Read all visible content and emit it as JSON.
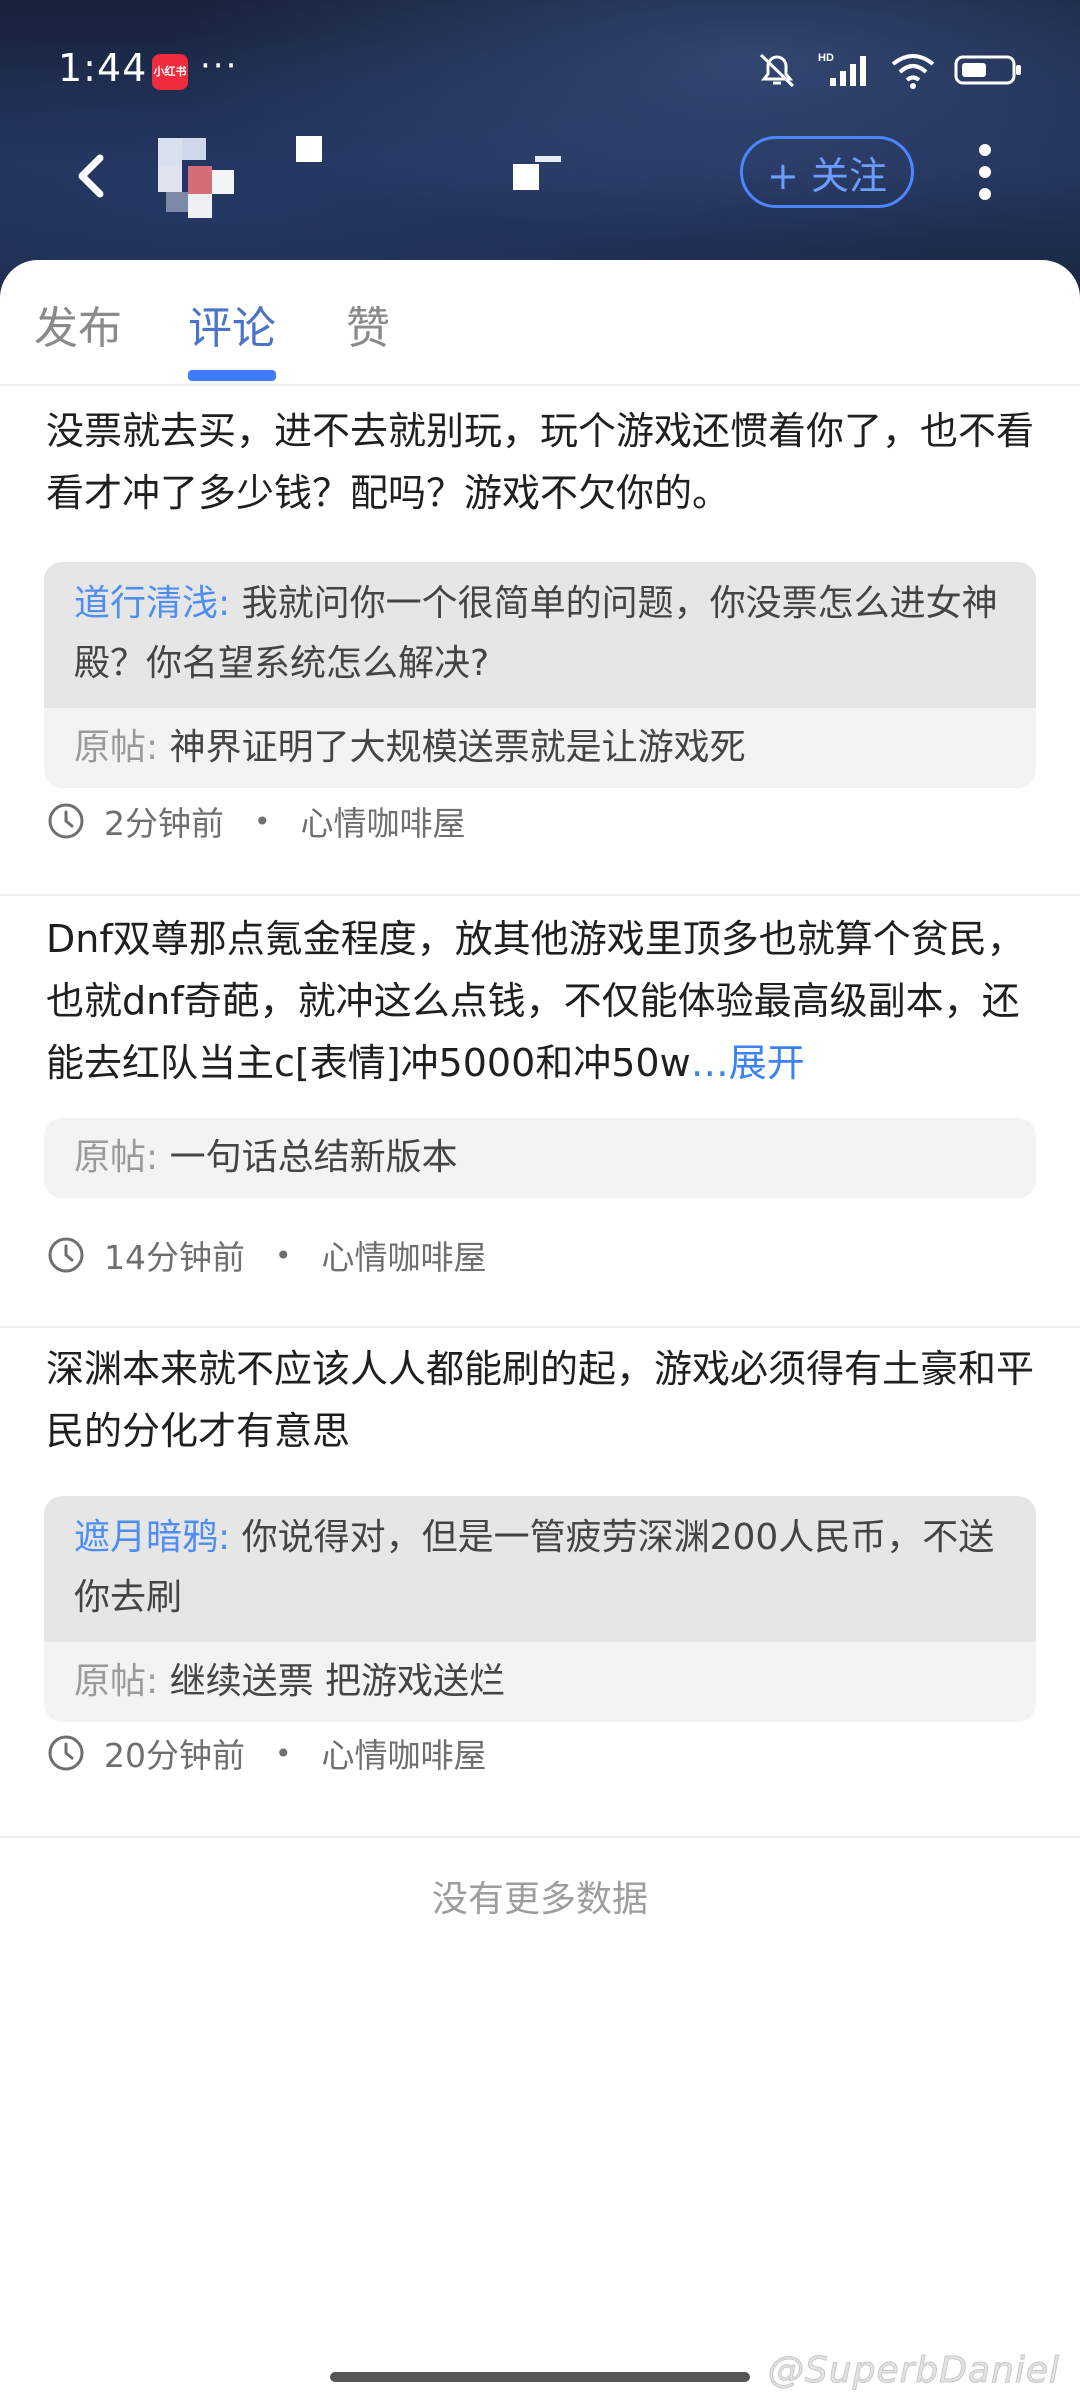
{
  "status_bar": {
    "time": "1:44",
    "app_badge": "小红书",
    "dots": "···"
  },
  "header": {
    "follow_label": "+ 关注"
  },
  "tabs": [
    {
      "label": "发布",
      "active": false
    },
    {
      "label": "评论",
      "active": true
    },
    {
      "label": "赞",
      "active": false
    }
  ],
  "comments": [
    {
      "text": "没票就去买，进不去就别玩，玩个游戏还惯着你了，也不看看才冲了多少钱？配吗？游戏不欠你的。",
      "reply_user": "道行清浅:",
      "reply_text": "我就问你一个很简单的问题，你没票怎么进女神殿？你名望系统怎么解决?",
      "orig_label": "原帖:",
      "orig_text": "神界证明了大规模送票就是让游戏死",
      "time": "2分钟前",
      "group": "心情咖啡屋"
    },
    {
      "text": "Dnf双尊那点氪金程度，放其他游戏里顶多也就算个贫民，也就dnf奇葩，就冲这么点钱，不仅能体验最高级副本，还能去红队当主c[表情]冲5000和冲50w",
      "expand": "…展开",
      "orig_label": "原帖:",
      "orig_text": "一句话总结新版本",
      "time": "14分钟前",
      "group": "心情咖啡屋"
    },
    {
      "text": "深渊本来就不应该人人都能刷的起，游戏必须得有土豪和平民的分化才有意思",
      "reply_user": "遮月暗鸦:",
      "reply_text": "你说得对，但是一管疲劳深渊200人民币，不送你去刷",
      "orig_label": "原帖:",
      "orig_text": "继续送票 把游戏送烂",
      "time": "20分钟前",
      "group": "心情咖啡屋"
    }
  ],
  "meta_separator": "•",
  "footer": {
    "no_more": "没有更多数据"
  },
  "watermark": "@SuperbDaniel",
  "colors": {
    "accent": "#3f7bff",
    "reply_user": "#4e8ef2",
    "header_bg": "#1b2846"
  }
}
